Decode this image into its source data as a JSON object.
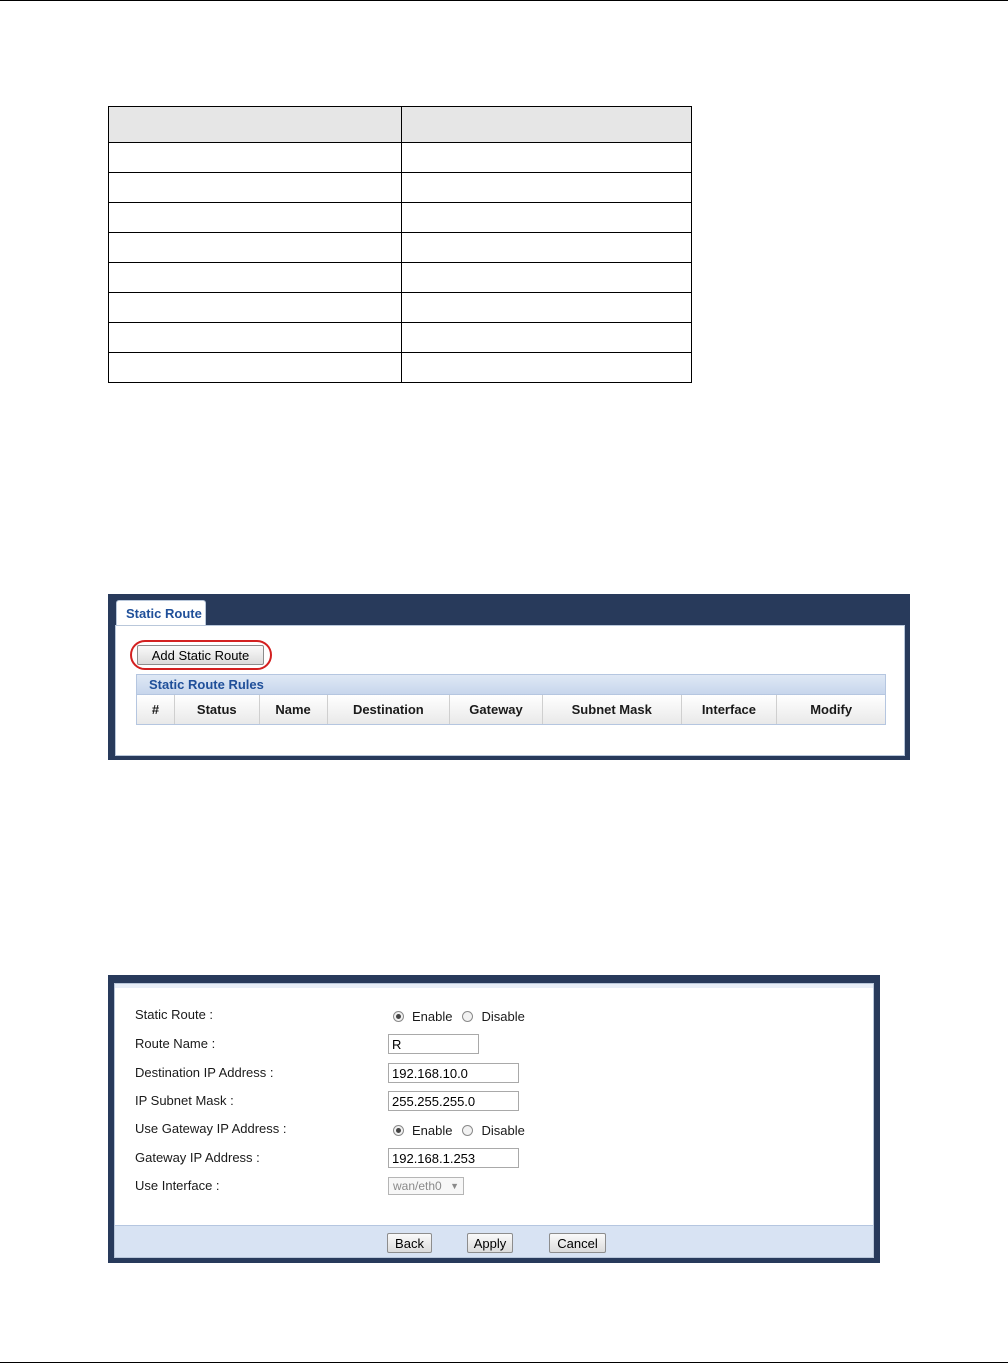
{
  "static_route_screen": {
    "tab_label": "Static Route",
    "add_button_label": "Add Static Route",
    "rules_title": "Static Route Rules",
    "columns": [
      "#",
      "Status",
      "Name",
      "Destination",
      "Gateway",
      "Subnet Mask",
      "Interface",
      "Modify"
    ]
  },
  "route_form": {
    "static_route_label": "Static Route :",
    "static_route_enable": "Enable",
    "static_route_disable": "Disable",
    "route_name_label": "Route Name :",
    "route_name_value": "R",
    "destination_label": "Destination IP Address :",
    "destination_value": "192.168.10.0",
    "subnet_label": "IP Subnet Mask :",
    "subnet_value": "255.255.255.0",
    "use_gateway_label": "Use Gateway IP Address :",
    "use_gateway_enable": "Enable",
    "use_gateway_disable": "Disable",
    "gateway_label": "Gateway IP Address :",
    "gateway_value": "192.168.1.253",
    "interface_label": "Use Interface :",
    "interface_value": "wan/eth0",
    "back_label": "Back",
    "apply_label": "Apply",
    "cancel_label": "Cancel"
  },
  "colors": {
    "frame": "#283a5b",
    "title_blue": "#1f4f99",
    "highlight_circle": "#d32020"
  }
}
